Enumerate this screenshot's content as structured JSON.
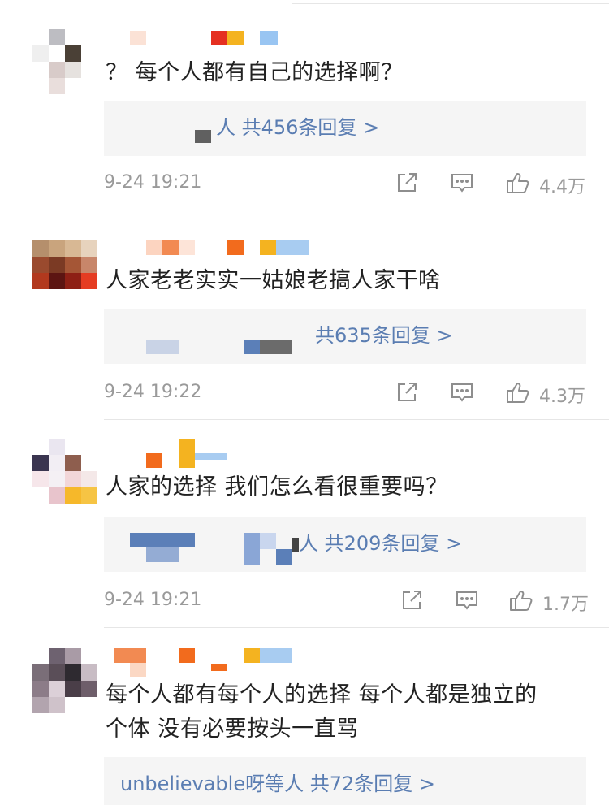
{
  "comments": [
    {
      "text": "？ 每个人都有自己的选择啊？",
      "reply_link": "人  共456条回复 >",
      "time": "9-24 19:21",
      "likes": "4.4万"
    },
    {
      "text": "人家老老实实一姑娘老搞人家干啥",
      "reply_link": "共635条回复 >",
      "time": "9-24 19:22",
      "likes": "4.3万"
    },
    {
      "text": "人家的选择 我们怎么看很重要吗？",
      "reply_link": "人  共209条回复 >",
      "time": "9-24 19:21",
      "likes": "1.7万"
    },
    {
      "text_line1": "每个人都有每个人的选择 每个人都是独立的",
      "text_line2": "个体 没有必要按头一直骂",
      "reply_link": "unbelievable呀等人  共72条回复 >"
    }
  ],
  "icons": [
    "share-icon",
    "comment-icon",
    "like-icon"
  ],
  "colors": {
    "link": "#5a7db2",
    "meta": "#9a9a9a",
    "reply_bg": "#f5f5f5"
  }
}
